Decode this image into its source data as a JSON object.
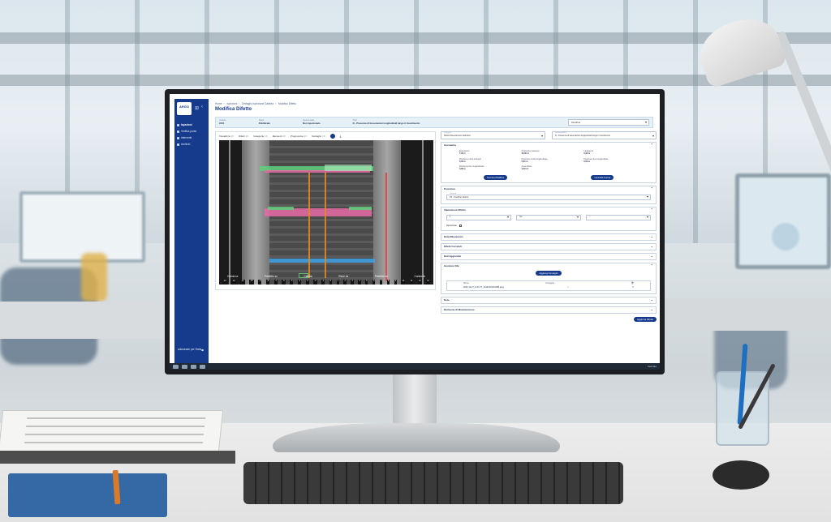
{
  "app": {
    "logo_text": "ARGO",
    "logo_subtext": "",
    "footer_brand": "autostrade per l'italia"
  },
  "sidebar": {
    "items": [
      {
        "label": "Ispezioni",
        "icon": "dashboard-icon"
      },
      {
        "label": "Verifica punto",
        "icon": "check-icon"
      },
      {
        "label": "Interventi",
        "icon": "wrench-icon"
      },
      {
        "label": "Archivio",
        "icon": "archive-icon"
      }
    ]
  },
  "breadcrumb": [
    "Home",
    "Ispezioni",
    "Dettaglio Ispezione Galleria",
    "Modifica Difetto"
  ],
  "page": {
    "title": "Modifica Difetto"
  },
  "info_bar": {
    "cells": [
      {
        "key": "Codice",
        "value": "1001"
      },
      {
        "key": "Stato",
        "value": "Pubblicato"
      },
      {
        "key": "Ispezionato",
        "value": "Non Ispezionato"
      },
      {
        "key": "Tipo",
        "value": "D - Presenza di fessurazioni longitudinali lungo il rivestimento"
      }
    ],
    "select_value": "Modifica"
  },
  "viewer": {
    "tools": [
      {
        "label": "Visualizza",
        "value": "1X"
      },
      {
        "label": "Difetti",
        "value": "1X"
      },
      {
        "label": "Categorie",
        "value": "1X"
      },
      {
        "label": "Elementi",
        "value": "1X"
      },
      {
        "label": "Progressiva",
        "value": "1X"
      },
      {
        "label": "Dettaglio",
        "value": "1X"
      }
    ],
    "axis_labels": [
      "Corsia sx",
      "Piedritto sx",
      "Calotta",
      "Rene dx",
      "Piedritto dx",
      "Corsia dx"
    ],
    "ticks": [
      "-13",
      "-12",
      "-11",
      "-10",
      "-9",
      "-8",
      "-7",
      "-6",
      "-5",
      "-4",
      "-3",
      "-2",
      "-1",
      "0",
      "1",
      "2",
      "3",
      "4",
      "5",
      "6",
      "7",
      "8",
      "9",
      "10",
      "11",
      "12",
      "13"
    ]
  },
  "panel": {
    "select_left": {
      "label": "Categoria",
      "value": "Difetto Rivestimento definitivo"
    },
    "select_right": {
      "label": "Sottocategoria",
      "value": "D - Presenza di fessurazioni longitudinali lungo il rivestimento"
    },
    "geometria": {
      "title": "Geometria",
      "fields": [
        {
          "key": "Estensione",
          "value": "7,00 m"
        },
        {
          "key": "Ampiezza massima",
          "value": "60,00 m"
        },
        {
          "key": "Larghezza",
          "value": "0,00 m"
        },
        {
          "key": "Posizione inizio sviluppo",
          "value": "0,00 m"
        },
        {
          "key": "Posizione inizio longitudinale",
          "value": "0,00 m"
        },
        {
          "key": "Posizione fine longitudinale",
          "value": "0,00 m"
        },
        {
          "key": "Posizione fine longitudinale",
          "value": "0,00 m"
        },
        {
          "key": "Area difetto",
          "value": "0,00 m²"
        }
      ],
      "btn_edit": "Termina Modifica",
      "btn_delete": "Cancella Forma"
    },
    "posizione": {
      "title": "Posizione",
      "select_label": "Posizione",
      "select_value": "P3 - Piedritto Destro"
    },
    "valutazione": {
      "title": "Valutazione Difetto",
      "selects": [
        "1",
        "G2",
        "-"
      ],
      "checkbox_label": "Ripristinato"
    },
    "collapsed_sections": [
      "Data Rilevazione",
      "Difetti Correlati",
      "Dati Aggiuntivi"
    ],
    "allegati": {
      "title": "Gestione File",
      "add_button": "Aggiungi Immagini",
      "col_name": "Nome",
      "col_action": "Immagine",
      "file_name": "2022-10-27_A-01-FT_20191204001965.jpeg",
      "file_mark": "✓"
    },
    "tail_sections": [
      "Note",
      "Richiesta di Manutenzione"
    ],
    "save_button": "Aggiorna Difetto"
  },
  "taskbar": {
    "clock": "Caricato"
  },
  "colors": {
    "brand": "#173b8c",
    "info_bg": "#e6f0f7",
    "defect_green": "#5fd07a",
    "defect_pink": "#e86aa5",
    "defect_blue": "#3da3e8",
    "defect_orange": "#e8891a",
    "defect_red": "#e83a3a"
  }
}
